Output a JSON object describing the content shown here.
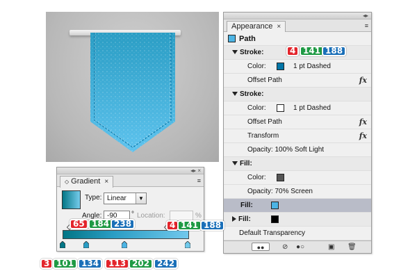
{
  "appearance": {
    "tab_label": "Appearance",
    "path_label": "Path",
    "rows": {
      "stroke1_label": "Stroke:",
      "stroke1_color_label": "Color:",
      "stroke1_color_value": "1 pt Dashed",
      "stroke1_effect": "Offset Path",
      "stroke2_label": "Stroke:",
      "stroke2_color_label": "Color:",
      "stroke2_color_value": "1 pt Dashed",
      "stroke2_effect": "Offset Path",
      "stroke2_transform": "Transform",
      "stroke2_opacity": "Opacity: 100% Soft Light",
      "fill1_label": "Fill:",
      "fill1_color_label": "Color:",
      "fill1_opacity": "Opacity: 70% Screen",
      "fill2_label": "Fill:",
      "fill3_label": "Fill:",
      "default_transparency": "Default Transparency"
    },
    "fx_label": "fx",
    "colors": {
      "stroke1_swatch": "#0476a8",
      "stroke2_swatch": "#ffffff",
      "fill1_swatch": "#555555",
      "fill2_swatch": "#4cb4e4",
      "fill3_swatch": "#000000"
    }
  },
  "gradient": {
    "tab_label": "Gradient",
    "type_label": "Type:",
    "type_value": "Linear",
    "angle_label": "Angle:",
    "angle_value": "-90",
    "degree_symbol": "°",
    "location_label": "Location:",
    "percent_symbol": "%",
    "colors": {
      "start": "#037686",
      "end": "#71caec"
    }
  },
  "badges": {
    "stroke_rgb": [
      "4",
      "141",
      "188"
    ],
    "gradient_mid_rgb": [
      "65",
      "184",
      "238"
    ],
    "gradient_right_rgb": [
      "4",
      "141",
      "188"
    ],
    "gradient_bottom_rgb": [
      "3",
      "101",
      "134",
      "113",
      "202",
      "242"
    ]
  },
  "icons": {
    "close": "×",
    "menu": "≡",
    "dropdown": "▼"
  }
}
